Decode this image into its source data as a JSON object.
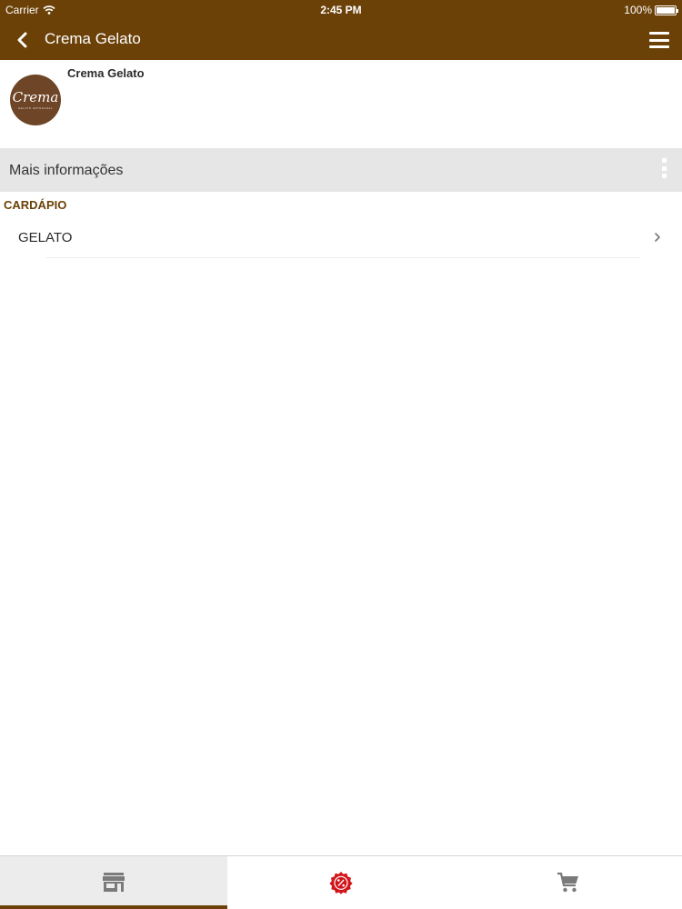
{
  "status_bar": {
    "carrier": "Carrier",
    "time": "2:45 PM",
    "battery": "100%"
  },
  "nav": {
    "title": "Crema Gelato",
    "bar_color": "#6b4108"
  },
  "store": {
    "name": "Crema Gelato",
    "logo_text": "Crema",
    "logo_subtext": "GELATO ARTESANAL",
    "logo_color": "#6e4526"
  },
  "more_info": {
    "label": "Mais informações"
  },
  "menu": {
    "section_title": "CARDÁPIO",
    "categories": [
      {
        "label": "GELATO"
      }
    ]
  },
  "tabs": [
    {
      "icon": "store-icon",
      "active": true
    },
    {
      "icon": "discount-badge-icon",
      "active": false
    },
    {
      "icon": "cart-icon",
      "active": false
    }
  ],
  "colors": {
    "accent": "#6b4108",
    "promo_red": "#d0161c",
    "icon_gray": "#7a7a7a"
  }
}
